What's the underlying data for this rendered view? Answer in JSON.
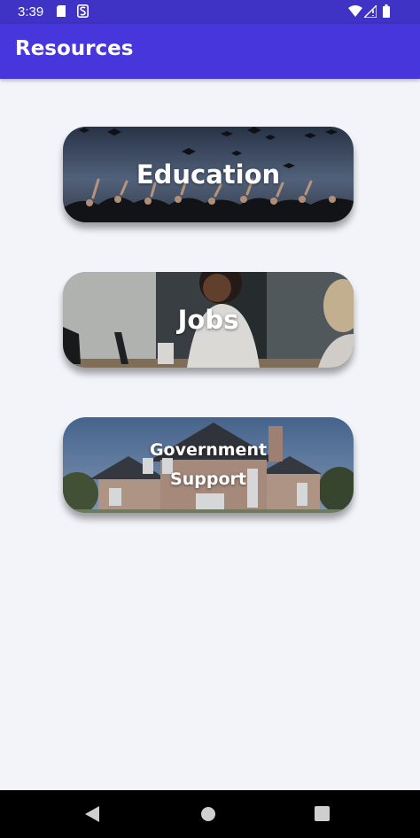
{
  "status_bar": {
    "time": "3:39",
    "icons": [
      "sd-card-icon",
      "s-notification-icon",
      "wifi-icon",
      "signal-icon",
      "battery-icon"
    ]
  },
  "app_bar": {
    "title": "Resources",
    "color": "#4636dc"
  },
  "cards": [
    {
      "label": "Education",
      "image": "graduation-caps-photo"
    },
    {
      "label": "Jobs",
      "image": "office-workers-photo"
    },
    {
      "label": "Government Support",
      "image": "house-photo"
    }
  ],
  "nav_bar": {
    "buttons": [
      "back-icon",
      "home-icon",
      "recents-icon"
    ]
  }
}
